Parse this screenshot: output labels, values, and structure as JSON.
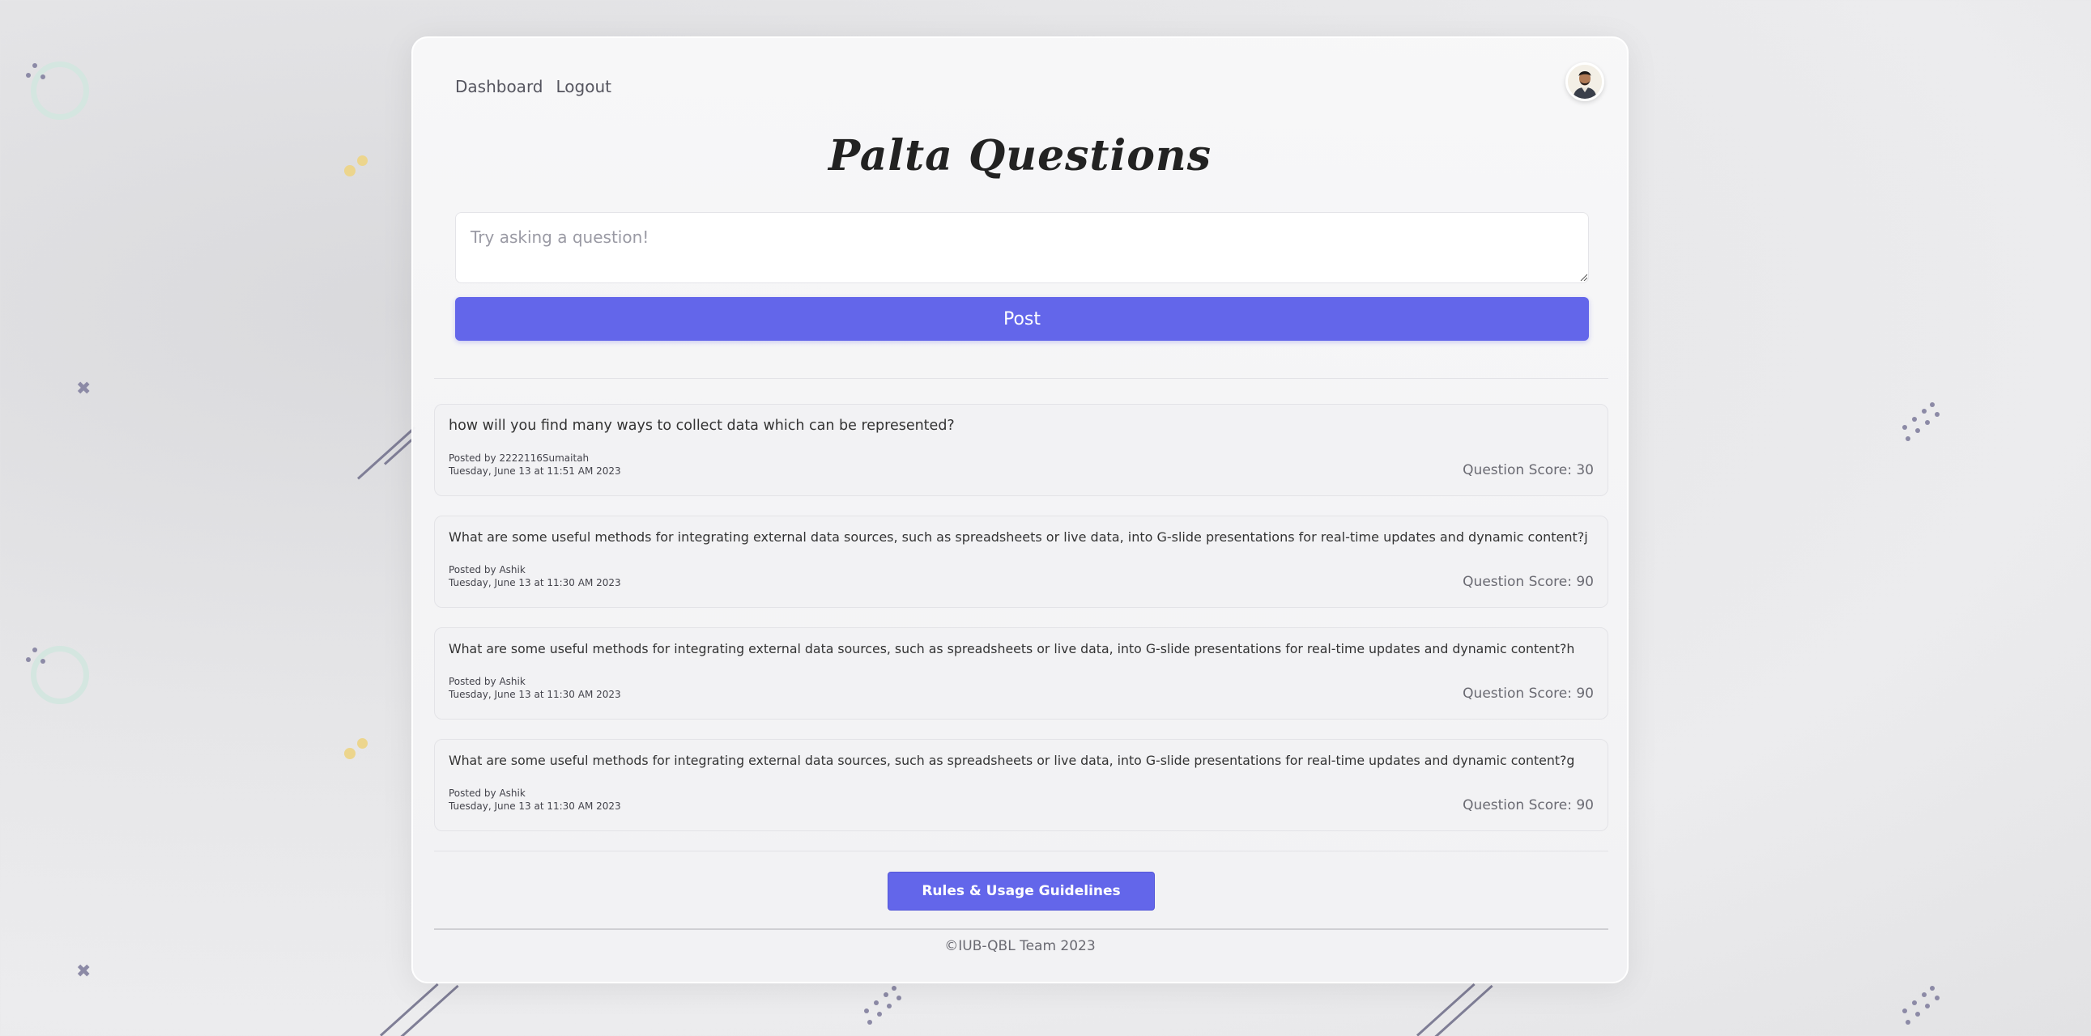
{
  "nav": {
    "dashboard": "Dashboard",
    "logout": "Logout"
  },
  "header": {
    "title": "Palta Questions"
  },
  "ask": {
    "placeholder": "Try asking a question!",
    "post_label": "Post"
  },
  "questions": [
    {
      "text": "how will you find many ways to collect data which can be represented?",
      "posted_by": "Posted by 2222116Sumaitah",
      "date": "Tuesday, June 13 at 11:51 AM 2023",
      "score": "Question Score: 30"
    },
    {
      "text": "What are some useful methods for integrating external data sources, such as spreadsheets or live data, into G-slide presentations for real-time updates and dynamic content?j",
      "posted_by": "Posted by Ashik",
      "date": "Tuesday, June 13 at 11:30 AM 2023",
      "score": "Question Score: 90"
    },
    {
      "text": "What are some useful methods for integrating external data sources, such as spreadsheets or live data, into G-slide presentations for real-time updates and dynamic content?h",
      "posted_by": "Posted by Ashik",
      "date": "Tuesday, June 13 at 11:30 AM 2023",
      "score": "Question Score: 90"
    },
    {
      "text": "What are some useful methods for integrating external data sources, such as spreadsheets or live data, into G-slide presentations for real-time updates and dynamic content?g",
      "posted_by": "Posted by Ashik",
      "date": "Tuesday, June 13 at 11:30 AM 2023",
      "score": "Question Score: 90"
    }
  ],
  "rules": {
    "label": "Rules & Usage Guidelines"
  },
  "footer": {
    "text": "©IUB-QBL Team 2023"
  },
  "colors": {
    "accent": "#6366ea",
    "background": "#e6e6e8",
    "card": "#f2f2f4"
  },
  "icons": {
    "avatar": "user-avatar-photo",
    "decorations": [
      "ring",
      "dots",
      "cross",
      "diagonal-lines"
    ]
  }
}
